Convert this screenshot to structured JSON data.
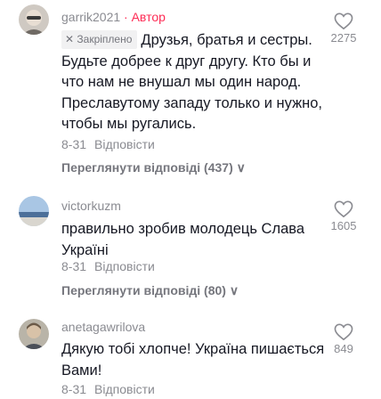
{
  "comments": [
    {
      "username": "garrik2021",
      "author_badge": " · Автор",
      "pinned_label": "Закріплено",
      "text": "Друзья, братья и сестры. Будьте добрее к друг другу. Кто бы и что нам не внушал мы один народ. Преславутому западу только и нужно, чтобы мы ругались.",
      "date": "8-31",
      "reply_label": "Відповісти",
      "view_replies": "Переглянути відповіді (437)",
      "likes": "2275"
    },
    {
      "username": "victorkuzm",
      "text": "правильно зробив молодець Слава Україні",
      "date": "8-31",
      "reply_label": "Відповісти",
      "view_replies": "Переглянути відповіді (80)",
      "likes": "1605"
    },
    {
      "username": "anetagawrilova",
      "text": "Дякую тобі хлопче! Україна пишається Вами!",
      "date": "8-31",
      "reply_label": "Відповісти",
      "likes": "849"
    }
  ],
  "colors": {
    "author": "#fe2c55",
    "muted": "#8a8b91",
    "text": "#161823"
  }
}
